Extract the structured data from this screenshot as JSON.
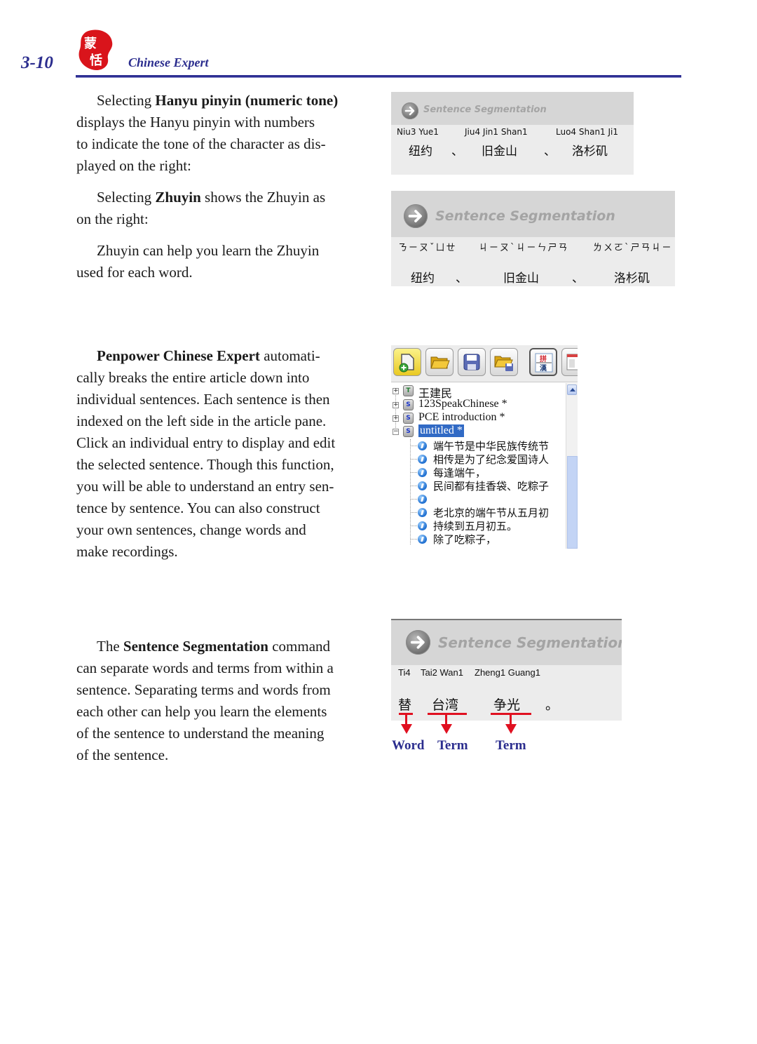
{
  "header": {
    "page_number": "3-10",
    "logo_icon": "red-seal-logo-icon",
    "book_title": "Chinese Expert"
  },
  "paragraphs": {
    "p1": {
      "pre": "Selecting ",
      "bold": "Hanyu pinyin (numeric tone)",
      "post_lines": [
        "displays the Hanyu pinyin with numbers",
        "to indicate the tone of the character as dis-",
        "played on the right:"
      ]
    },
    "p2": {
      "pre": "Selecting ",
      "bold": "Zhuyin",
      "post": " shows the Zhuyin as",
      "line2": "on the right:"
    },
    "p3": {
      "line1": "Zhuyin can help you learn the Zhuyin",
      "line2": "used for each word."
    },
    "p4": {
      "bold": "Penpower Chinese Expert",
      "post": " automati-",
      "lines": [
        "cally breaks the entire article down into",
        "individual sentences. Each sentence is then",
        "indexed on the left side in the article pane.",
        "Click an individual entry to display and edit",
        "the selected sentence. Though this function,",
        "you will be able to understand an entry sen-",
        "tence by sentence. You can also construct",
        "your own sentences, change words and",
        "make recordings."
      ]
    },
    "p5": {
      "pre": "The ",
      "bold": "Sentence Segmentation",
      "post": " command",
      "lines": [
        "can separate words and terms from within a",
        "sentence. Separating terms and words from",
        "each other can help you learn the elements",
        "of the sentence to understand the meaning",
        "of the sentence."
      ]
    }
  },
  "panel_pinyin": {
    "title": "Sentence Segmentation",
    "pinyin": [
      "Niu3 Yue1",
      "Jiu4 Jin1 Shan1",
      "Luo4 Shan1 Ji1"
    ],
    "hanzi": [
      "纽约",
      "、",
      "旧金山",
      "、",
      "洛杉矶"
    ]
  },
  "panel_zhuyin": {
    "title": "Sentence Segmentation",
    "zhuyin": [
      "ㄋㄧㄡˇㄩㄝ",
      "ㄐㄧㄡˋㄐㄧㄣㄕㄢ",
      "ㄌㄨㄛˋㄕㄢㄐㄧ"
    ],
    "hanzi": [
      "纽约",
      "、",
      "旧金山",
      "、",
      "洛杉矶"
    ]
  },
  "article_pane": {
    "toolbar": [
      {
        "name": "new-document-button",
        "icon": "new-document-icon"
      },
      {
        "name": "open-folder-button",
        "icon": "open-folder-icon"
      },
      {
        "name": "save-button",
        "icon": "floppy-disk-icon"
      },
      {
        "name": "save-as-button",
        "icon": "folder-save-icon"
      },
      {
        "name": "pinyin-chinese-toggle-button",
        "icon": "pinyin-han-icon",
        "glyph_top": "拼",
        "glyph_bottom": "漢"
      },
      {
        "name": "view-layout-button",
        "icon": "layout-icon"
      }
    ],
    "documents": [
      {
        "label": "王建民",
        "icon_letter": "T",
        "expander": "+"
      },
      {
        "label": "123SpeakChinese *",
        "icon_letter": "S",
        "expander": "+"
      },
      {
        "label": "PCE introduction *",
        "icon_letter": "S",
        "expander": "+"
      },
      {
        "label": "untitled *",
        "icon_letter": "S",
        "expander": "−",
        "selected": true
      }
    ],
    "sentences": [
      "端午节是中华民族传统节",
      "相传是为了纪念爱国诗人",
      "每逢端午，",
      "民间都有挂香袋、吃粽子",
      "",
      "老北京的端午节从五月初",
      "持续到五月初五。",
      "除了吃粽子，"
    ]
  },
  "panel_segment": {
    "title": "Sentence Segmentation",
    "pinyin": [
      "Ti4",
      "Tai2 Wan1",
      "Zheng1 Guang1"
    ],
    "hanzi": [
      "替",
      "台湾",
      "争光",
      "。"
    ],
    "labels": [
      "Word",
      "Term",
      "Term"
    ],
    "accent_color": "#e01020",
    "label_color": "#2b2d8e"
  }
}
